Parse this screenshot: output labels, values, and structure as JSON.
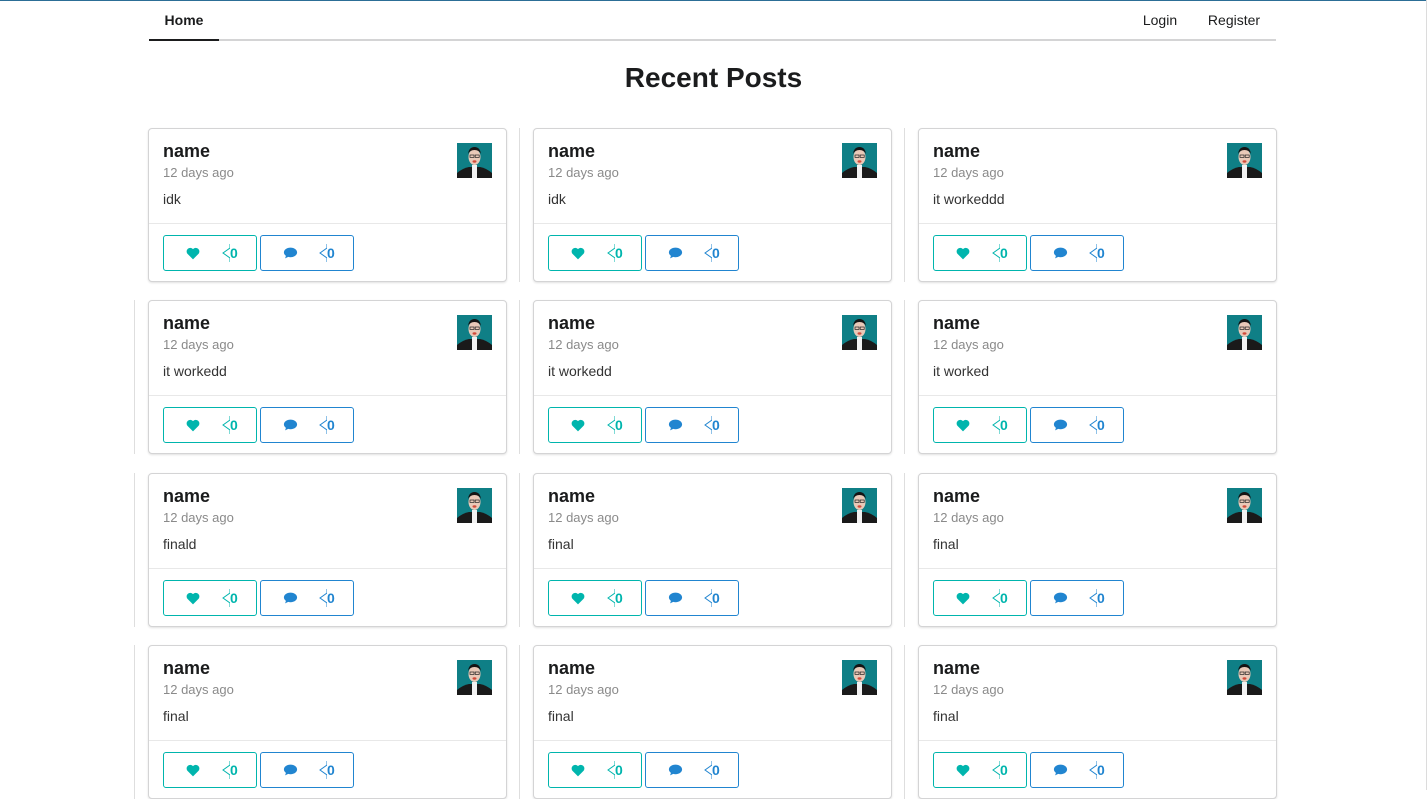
{
  "nav": {
    "home": "Home",
    "login": "Login",
    "register": "Register"
  },
  "page_title": "Recent Posts",
  "colors": {
    "like": "#00b5ad",
    "comment": "#2185d0"
  },
  "posts": [
    {
      "author": "name",
      "time": "12 days ago",
      "body": "idk",
      "likes": "0",
      "comments": "0"
    },
    {
      "author": "name",
      "time": "12 days ago",
      "body": "idk",
      "likes": "0",
      "comments": "0"
    },
    {
      "author": "name",
      "time": "12 days ago",
      "body": "it workeddd",
      "likes": "0",
      "comments": "0"
    },
    {
      "author": "name",
      "time": "12 days ago",
      "body": "it workedd",
      "likes": "0",
      "comments": "0"
    },
    {
      "author": "name",
      "time": "12 days ago",
      "body": "it workedd",
      "likes": "0",
      "comments": "0"
    },
    {
      "author": "name",
      "time": "12 days ago",
      "body": "it worked",
      "likes": "0",
      "comments": "0"
    },
    {
      "author": "name",
      "time": "12 days ago",
      "body": "finald",
      "likes": "0",
      "comments": "0"
    },
    {
      "author": "name",
      "time": "12 days ago",
      "body": "final",
      "likes": "0",
      "comments": "0"
    },
    {
      "author": "name",
      "time": "12 days ago",
      "body": "final",
      "likes": "0",
      "comments": "0"
    },
    {
      "author": "name",
      "time": "12 days ago",
      "body": "final",
      "likes": "0",
      "comments": "0"
    },
    {
      "author": "name",
      "time": "12 days ago",
      "body": "final",
      "likes": "0",
      "comments": "0"
    },
    {
      "author": "name",
      "time": "12 days ago",
      "body": "final",
      "likes": "0",
      "comments": "0"
    }
  ]
}
